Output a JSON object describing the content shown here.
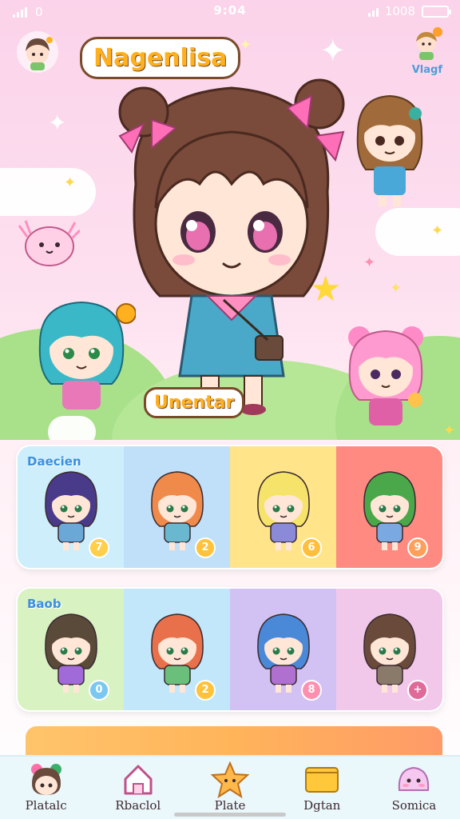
{
  "status_bar": {
    "left_text": "0",
    "time": "9:04",
    "right_text": "1008"
  },
  "header": {
    "title": "Nagenlisa",
    "corner_label": "Vlagf"
  },
  "hero": {
    "character_label": "Unentar"
  },
  "grid_1": {
    "tag": "Daecien",
    "cells": [
      {
        "name": "cat-ear-purple-girl",
        "bg": "#cdeefa",
        "hair": "#4a3a8a",
        "outfit": "#6aa8d8",
        "badge": "7",
        "badge_color": "#ffcf4a"
      },
      {
        "name": "fox-ear-orange-girl",
        "bg": "#bfe0f8",
        "hair": "#f08a4a",
        "outfit": "#6ab8d0",
        "badge": "2",
        "badge_color": "#ffc23a"
      },
      {
        "name": "blonde-girl",
        "bg": "#ffe48a",
        "hair": "#f6e36a",
        "outfit": "#8a8ad8",
        "badge": "6",
        "badge_color": "#ffbf3a"
      },
      {
        "name": "green-hair-girl",
        "bg": "#ff8a82",
        "hair": "#4aa84a",
        "outfit": "#7aa8e0",
        "badge": "9",
        "badge_color": "#ff9f5a"
      }
    ]
  },
  "grid_2": {
    "tag": "Baob",
    "cells": [
      {
        "name": "dark-hair-girl",
        "bg": "#d8f2c2",
        "hair": "#5a4a3a",
        "outfit": "#a06ad8",
        "badge": "0",
        "badge_color": "#7ac8f0"
      },
      {
        "name": "redhead-girl",
        "bg": "#c2e6fa",
        "hair": "#e8704a",
        "outfit": "#6ac07a",
        "badge": "2",
        "badge_color": "#ffc23a"
      },
      {
        "name": "blue-hair-girl",
        "bg": "#d2c2f4",
        "hair": "#4a88d8",
        "outfit": "#b070d0",
        "badge": "8",
        "badge_color": "#ff8fb0"
      },
      {
        "name": "brown-hair-girl",
        "bg": "#f2c8ea",
        "hair": "#6a4a3a",
        "outfit": "#8a7a6a",
        "badge": "+",
        "badge_color": "#e06a9a"
      }
    ]
  },
  "nav": {
    "items": [
      {
        "label": "Platalc",
        "icon": "character-face-icon"
      },
      {
        "label": "Rbaclol",
        "icon": "home-icon"
      },
      {
        "label": "Plate",
        "icon": "star-character-icon"
      },
      {
        "label": "Dgtan",
        "icon": "card-folder-icon"
      },
      {
        "label": "Somica",
        "icon": "slime-pet-icon"
      }
    ]
  },
  "colors": {
    "title_orange": "#ffb01f",
    "outline_brown": "#7a4a2a",
    "pink_bg": "#fbd3ea",
    "nav_bg": "#eaf7fb"
  }
}
